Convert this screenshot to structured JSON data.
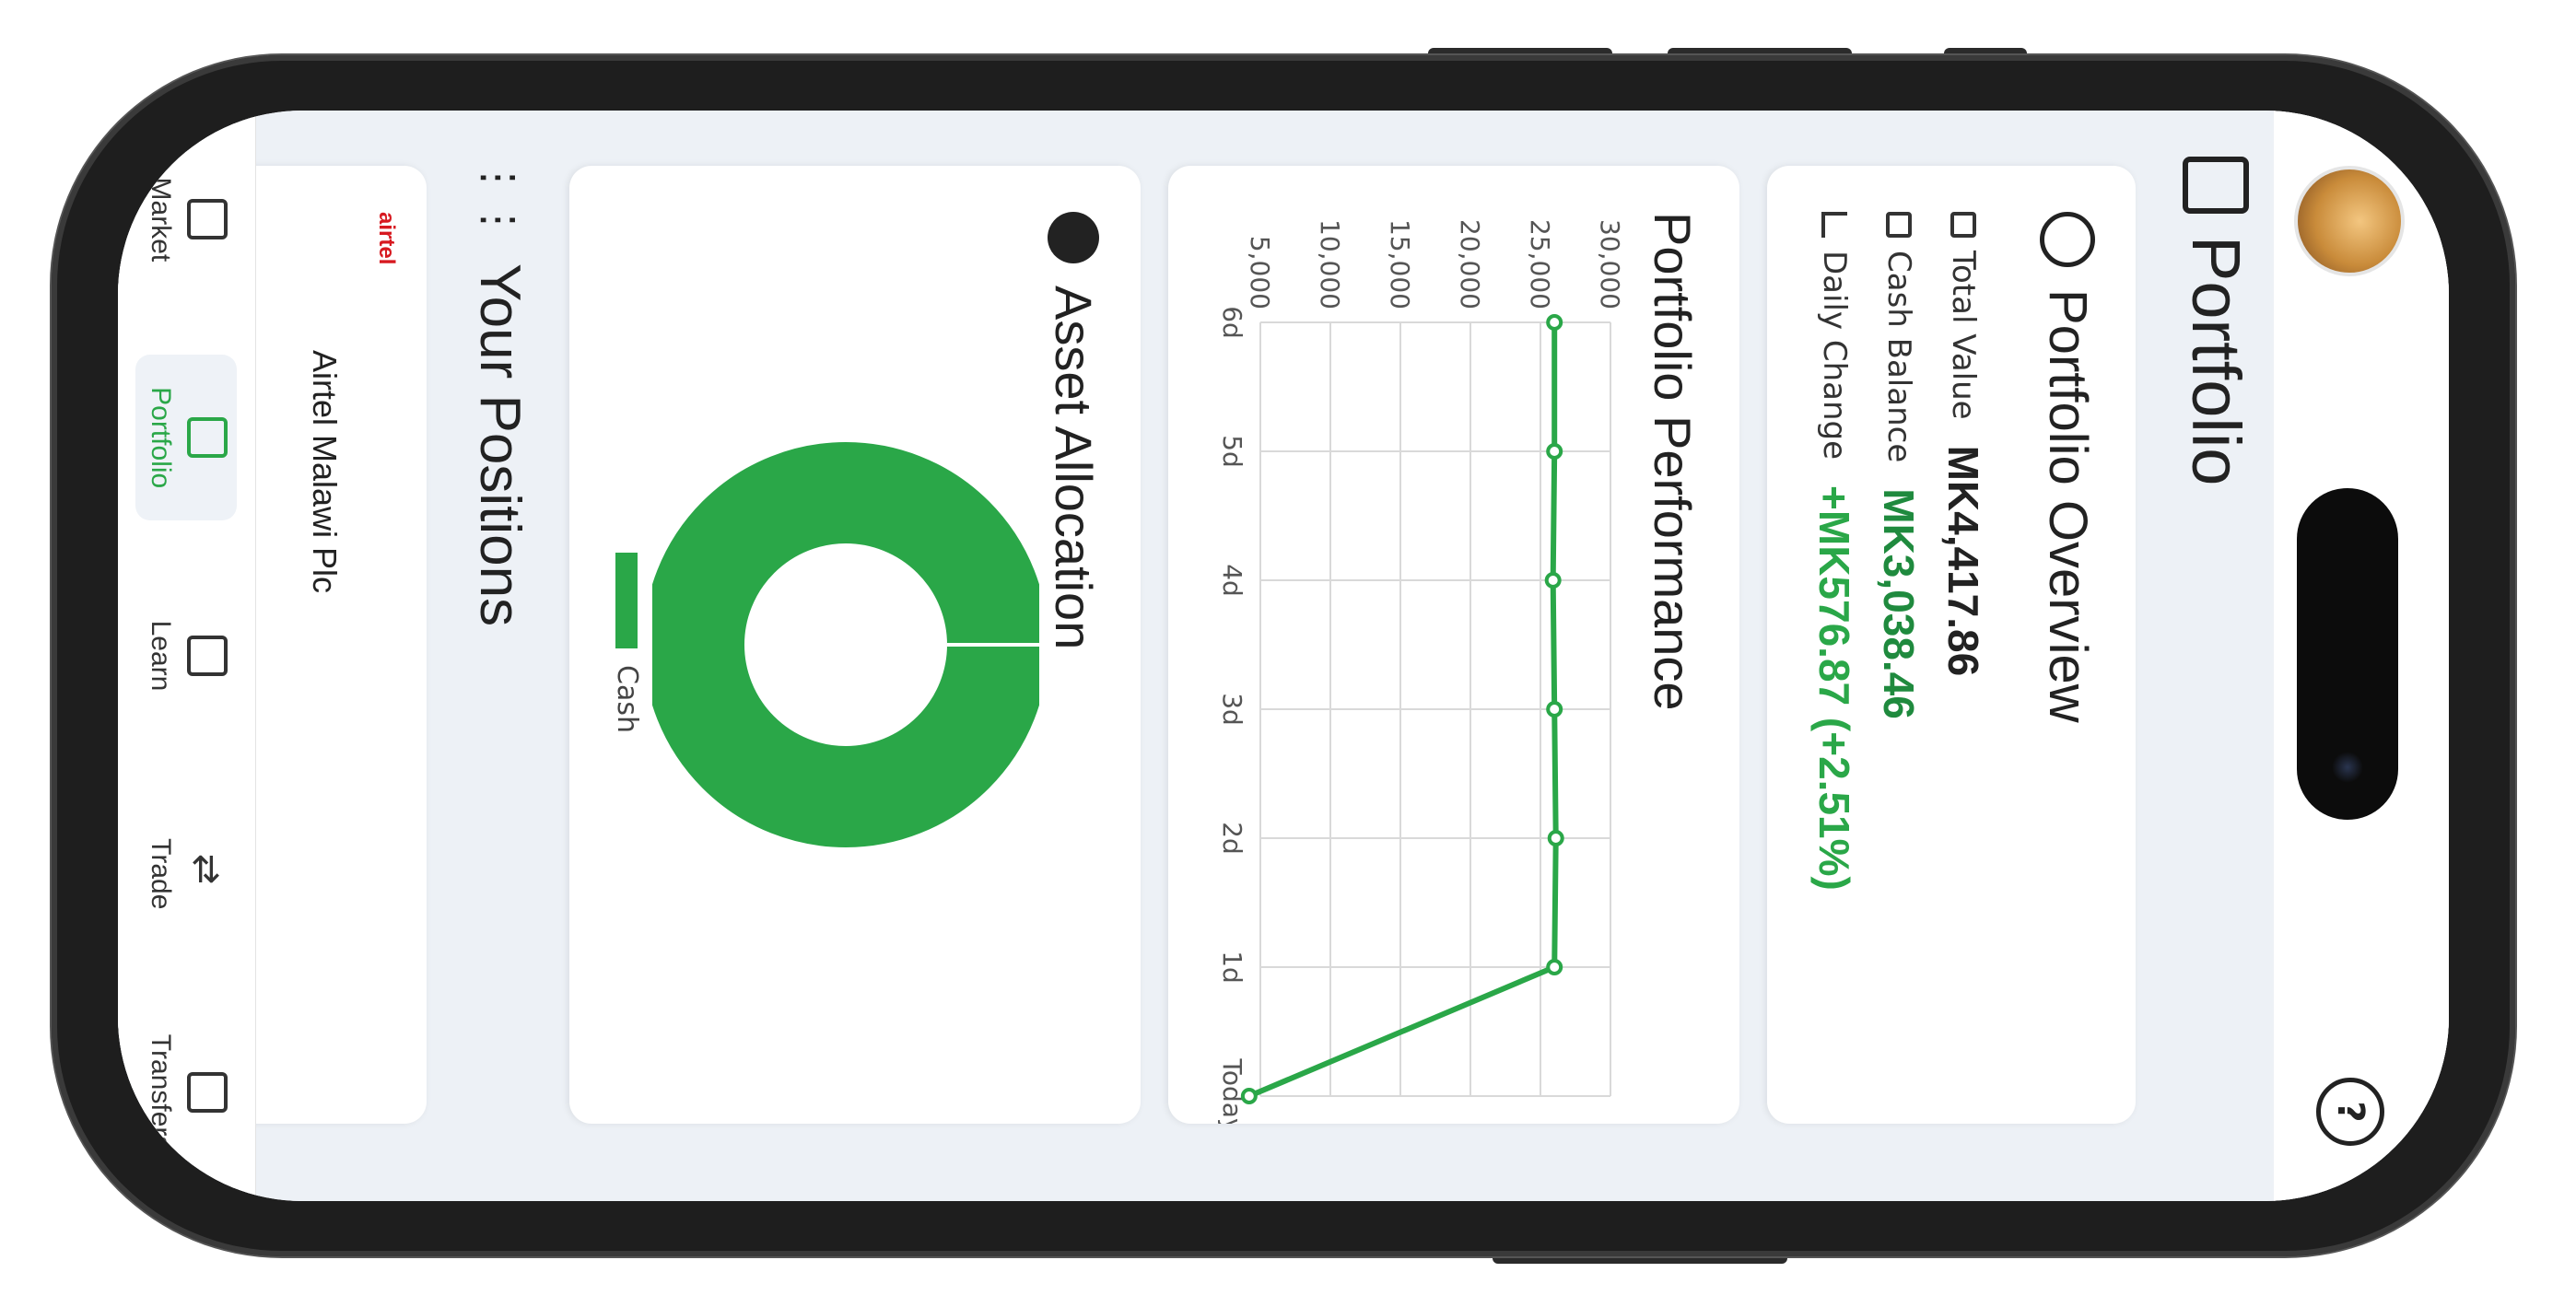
{
  "header": {
    "title": "Portfolio"
  },
  "overview": {
    "title": "Portfolio Overview",
    "total_value_label": "Total Value",
    "total_value": "MK4,417.86",
    "cash_balance_label": "Cash Balance",
    "cash_balance": "MK3,038.46",
    "daily_change_label": "Daily Change",
    "daily_change": "+MK576.87 (+2.51%)"
  },
  "performance": {
    "title": "Portfolio Performance"
  },
  "allocation": {
    "title": "Asset Allocation",
    "legend": "Cash"
  },
  "positions": {
    "title": "Your Positions",
    "items": [
      {
        "name": "Airtel Malawi Plc",
        "logo": "airtel"
      }
    ]
  },
  "nav": {
    "items": [
      {
        "label": "Market",
        "icon": "bar-chart-icon"
      },
      {
        "label": "Portfolio",
        "icon": "wallet-icon",
        "active": true
      },
      {
        "label": "Learn",
        "icon": "book-icon"
      },
      {
        "label": "Trade",
        "icon": "swap-arrows-icon"
      },
      {
        "label": "Transfers",
        "icon": "cash-icon"
      }
    ]
  },
  "colors": {
    "accent": "#2aa748",
    "background": "#edf1f6",
    "text": "#222222"
  },
  "chart_data": [
    {
      "type": "line",
      "title": "Portfolio Performance",
      "x": [
        "6d",
        "5d",
        "4d",
        "3d",
        "2d",
        "1d",
        "Today"
      ],
      "series": [
        {
          "values": [
            26000,
            26000,
            25900,
            26000,
            26100,
            26000,
            4200
          ]
        }
      ],
      "yticks": [
        "5,000",
        "10,000",
        "15,000",
        "20,000",
        "25,000",
        "30,000"
      ],
      "ylim": [
        5000,
        30000
      ],
      "grid": true
    },
    {
      "type": "pie",
      "title": "Asset Allocation",
      "categories": [
        "Cash"
      ],
      "values": [
        100
      ],
      "legend": "bottom"
    }
  ]
}
